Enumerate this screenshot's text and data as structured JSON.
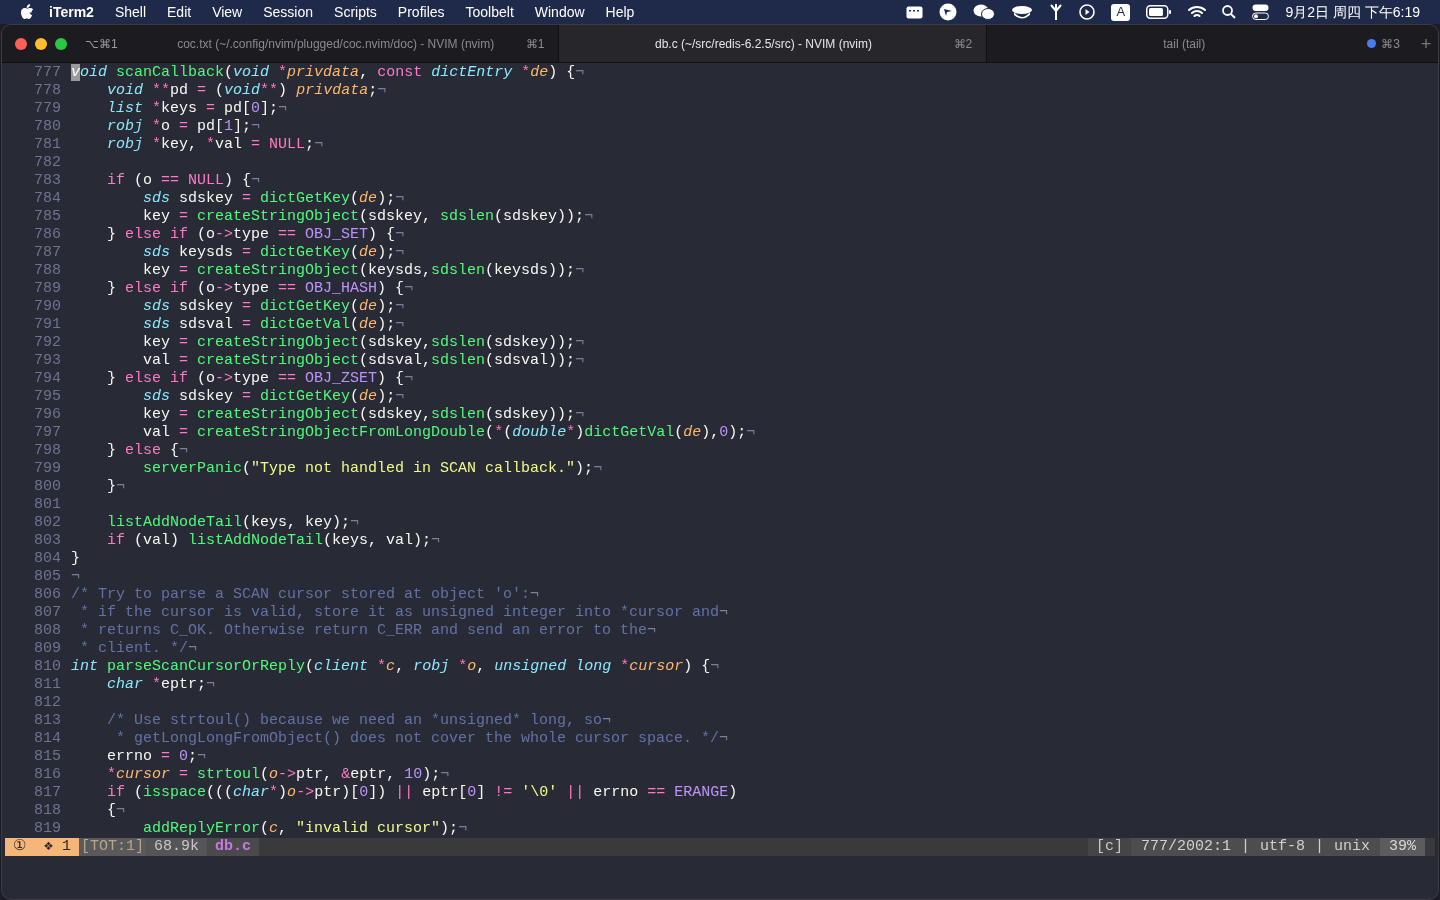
{
  "menu_bar": {
    "app": "iTerm2",
    "items": [
      "Shell",
      "Edit",
      "View",
      "Session",
      "Scripts",
      "Profiles",
      "Toolbelt",
      "Window",
      "Help"
    ],
    "input_source": "A",
    "clock": "9月2日 周四 下午6:19"
  },
  "window": {
    "shortcut": "⌥⌘1",
    "new_tab": "+",
    "tabs": [
      {
        "title": "coc.txt (~/.config/nvim/plugged/coc.nvim/doc) - NVIM (nvim)",
        "shortcut": "⌘1",
        "selected": false,
        "activity": false
      },
      {
        "title": "db.c (~/src/redis-6.2.5/src) - NVIM (nvim)",
        "shortcut": "⌘2",
        "selected": true,
        "activity": false
      },
      {
        "title": "tail (tail)",
        "shortcut": "⌘3",
        "selected": false,
        "activity": true
      }
    ]
  },
  "editor": {
    "lines": [
      {
        "number": "777",
        "tokens": [
          {
            "kind": "cursor",
            "text": "v"
          },
          {
            "kind": "type",
            "text": "oid"
          },
          {
            "kind": "func",
            "text": " scanCallback"
          },
          {
            "kind": "plain",
            "text": "("
          },
          {
            "kind": "type",
            "text": "void"
          },
          {
            "kind": "op",
            "text": " *"
          },
          {
            "kind": "param",
            "text": "privdata"
          },
          {
            "kind": "plain",
            "text": ", "
          },
          {
            "kind": "op",
            "text": "const"
          },
          {
            "kind": "type",
            "text": " dictEntry"
          },
          {
            "kind": "op",
            "text": " *"
          },
          {
            "kind": "param",
            "text": "de"
          },
          {
            "kind": "plain",
            "text": ") {"
          },
          {
            "kind": "eol",
            "text": "¬"
          }
        ]
      },
      {
        "number": "778",
        "tokens": [
          {
            "kind": "type",
            "text": "    void"
          },
          {
            "kind": "op",
            "text": " **"
          },
          {
            "kind": "plain",
            "text": "pd "
          },
          {
            "kind": "op",
            "text": "="
          },
          {
            "kind": "plain",
            "text": " ("
          },
          {
            "kind": "type",
            "text": "void"
          },
          {
            "kind": "op",
            "text": "**"
          },
          {
            "kind": "plain",
            "text": ") "
          },
          {
            "kind": "param",
            "text": "privdata"
          },
          {
            "kind": "plain",
            "text": ";"
          },
          {
            "kind": "eol",
            "text": "¬"
          }
        ]
      },
      {
        "number": "779",
        "tokens": [
          {
            "kind": "type",
            "text": "    list"
          },
          {
            "kind": "op",
            "text": " *"
          },
          {
            "kind": "plain",
            "text": "keys "
          },
          {
            "kind": "op",
            "text": "="
          },
          {
            "kind": "plain",
            "text": " pd["
          },
          {
            "kind": "num",
            "text": "0"
          },
          {
            "kind": "plain",
            "text": "];"
          },
          {
            "kind": "eol",
            "text": "¬"
          }
        ]
      },
      {
        "number": "780",
        "tokens": [
          {
            "kind": "type",
            "text": "    robj"
          },
          {
            "kind": "op",
            "text": " *"
          },
          {
            "kind": "plain",
            "text": "o "
          },
          {
            "kind": "op",
            "text": "="
          },
          {
            "kind": "plain",
            "text": " pd["
          },
          {
            "kind": "num",
            "text": "1"
          },
          {
            "kind": "plain",
            "text": "];"
          },
          {
            "kind": "eol",
            "text": "¬"
          }
        ]
      },
      {
        "number": "781",
        "tokens": [
          {
            "kind": "type",
            "text": "    robj"
          },
          {
            "kind": "op",
            "text": " *"
          },
          {
            "kind": "plain",
            "text": "key, "
          },
          {
            "kind": "op",
            "text": "*"
          },
          {
            "kind": "plain",
            "text": "val "
          },
          {
            "kind": "op",
            "text": "="
          },
          {
            "kind": "op",
            "text": " NULL"
          },
          {
            "kind": "plain",
            "text": ";"
          },
          {
            "kind": "eol",
            "text": "¬"
          }
        ]
      },
      {
        "number": "782"
      },
      {
        "number": "783",
        "tokens": [
          {
            "kind": "op",
            "text": "    if"
          },
          {
            "kind": "plain",
            "text": " (o "
          },
          {
            "kind": "op",
            "text": "=="
          },
          {
            "kind": "op",
            "text": " NULL"
          },
          {
            "kind": "plain",
            "text": ") {"
          },
          {
            "kind": "eol",
            "text": "¬"
          }
        ]
      },
      {
        "number": "784",
        "tokens": [
          {
            "kind": "type",
            "text": "        sds"
          },
          {
            "kind": "plain",
            "text": " sdskey "
          },
          {
            "kind": "op",
            "text": "="
          },
          {
            "kind": "func",
            "text": " dictGetKey"
          },
          {
            "kind": "plain",
            "text": "("
          },
          {
            "kind": "param",
            "text": "de"
          },
          {
            "kind": "plain",
            "text": ");"
          },
          {
            "kind": "eol",
            "text": "¬"
          }
        ]
      },
      {
        "number": "785",
        "tokens": [
          {
            "kind": "plain",
            "text": "        key "
          },
          {
            "kind": "op",
            "text": "="
          },
          {
            "kind": "func",
            "text": " createStringObject"
          },
          {
            "kind": "plain",
            "text": "(sdskey, "
          },
          {
            "kind": "func",
            "text": "sdslen"
          },
          {
            "kind": "plain",
            "text": "(sdskey));"
          },
          {
            "kind": "eol",
            "text": "¬"
          }
        ]
      },
      {
        "number": "786",
        "tokens": [
          {
            "kind": "plain",
            "text": "    } "
          },
          {
            "kind": "op",
            "text": "else if"
          },
          {
            "kind": "plain",
            "text": " (o"
          },
          {
            "kind": "op",
            "text": "->"
          },
          {
            "kind": "plain",
            "text": "type "
          },
          {
            "kind": "op",
            "text": "=="
          },
          {
            "kind": "const",
            "text": " OBJ_SET"
          },
          {
            "kind": "plain",
            "text": ") {"
          },
          {
            "kind": "eol",
            "text": "¬"
          }
        ]
      },
      {
        "number": "787",
        "tokens": [
          {
            "kind": "type",
            "text": "        sds"
          },
          {
            "kind": "plain",
            "text": " keysds "
          },
          {
            "kind": "op",
            "text": "="
          },
          {
            "kind": "func",
            "text": " dictGetKey"
          },
          {
            "kind": "plain",
            "text": "("
          },
          {
            "kind": "param",
            "text": "de"
          },
          {
            "kind": "plain",
            "text": ");"
          },
          {
            "kind": "eol",
            "text": "¬"
          }
        ]
      },
      {
        "number": "788",
        "tokens": [
          {
            "kind": "plain",
            "text": "        key "
          },
          {
            "kind": "op",
            "text": "="
          },
          {
            "kind": "func",
            "text": " createStringObject"
          },
          {
            "kind": "plain",
            "text": "(keysds,"
          },
          {
            "kind": "func",
            "text": "sdslen"
          },
          {
            "kind": "plain",
            "text": "(keysds));"
          },
          {
            "kind": "eol",
            "text": "¬"
          }
        ]
      },
      {
        "number": "789",
        "tokens": [
          {
            "kind": "plain",
            "text": "    } "
          },
          {
            "kind": "op",
            "text": "else if"
          },
          {
            "kind": "plain",
            "text": " (o"
          },
          {
            "kind": "op",
            "text": "->"
          },
          {
            "kind": "plain",
            "text": "type "
          },
          {
            "kind": "op",
            "text": "=="
          },
          {
            "kind": "const",
            "text": " OBJ_HASH"
          },
          {
            "kind": "plain",
            "text": ") {"
          },
          {
            "kind": "eol",
            "text": "¬"
          }
        ]
      },
      {
        "number": "790",
        "tokens": [
          {
            "kind": "type",
            "text": "        sds"
          },
          {
            "kind": "plain",
            "text": " sdskey "
          },
          {
            "kind": "op",
            "text": "="
          },
          {
            "kind": "func",
            "text": " dictGetKey"
          },
          {
            "kind": "plain",
            "text": "("
          },
          {
            "kind": "param",
            "text": "de"
          },
          {
            "kind": "plain",
            "text": ");"
          },
          {
            "kind": "eol",
            "text": "¬"
          }
        ]
      },
      {
        "number": "791",
        "tokens": [
          {
            "kind": "type",
            "text": "        sds"
          },
          {
            "kind": "plain",
            "text": " sdsval "
          },
          {
            "kind": "op",
            "text": "="
          },
          {
            "kind": "func",
            "text": " dictGetVal"
          },
          {
            "kind": "plain",
            "text": "("
          },
          {
            "kind": "param",
            "text": "de"
          },
          {
            "kind": "plain",
            "text": ");"
          },
          {
            "kind": "eol",
            "text": "¬"
          }
        ]
      },
      {
        "number": "792",
        "tokens": [
          {
            "kind": "plain",
            "text": "        key "
          },
          {
            "kind": "op",
            "text": "="
          },
          {
            "kind": "func",
            "text": " createStringObject"
          },
          {
            "kind": "plain",
            "text": "(sdskey,"
          },
          {
            "kind": "func",
            "text": "sdslen"
          },
          {
            "kind": "plain",
            "text": "(sdskey));"
          },
          {
            "kind": "eol",
            "text": "¬"
          }
        ]
      },
      {
        "number": "793",
        "tokens": [
          {
            "kind": "plain",
            "text": "        val "
          },
          {
            "kind": "op",
            "text": "="
          },
          {
            "kind": "func",
            "text": " createStringObject"
          },
          {
            "kind": "plain",
            "text": "(sdsval,"
          },
          {
            "kind": "func",
            "text": "sdslen"
          },
          {
            "kind": "plain",
            "text": "(sdsval));"
          },
          {
            "kind": "eol",
            "text": "¬"
          }
        ]
      },
      {
        "number": "794",
        "tokens": [
          {
            "kind": "plain",
            "text": "    } "
          },
          {
            "kind": "op",
            "text": "else if"
          },
          {
            "kind": "plain",
            "text": " (o"
          },
          {
            "kind": "op",
            "text": "->"
          },
          {
            "kind": "plain",
            "text": "type "
          },
          {
            "kind": "op",
            "text": "=="
          },
          {
            "kind": "const",
            "text": " OBJ_ZSET"
          },
          {
            "kind": "plain",
            "text": ") {"
          },
          {
            "kind": "eol",
            "text": "¬"
          }
        ]
      },
      {
        "number": "795",
        "tokens": [
          {
            "kind": "type",
            "text": "        sds"
          },
          {
            "kind": "plain",
            "text": " sdskey "
          },
          {
            "kind": "op",
            "text": "="
          },
          {
            "kind": "func",
            "text": " dictGetKey"
          },
          {
            "kind": "plain",
            "text": "("
          },
          {
            "kind": "param",
            "text": "de"
          },
          {
            "kind": "plain",
            "text": ");"
          },
          {
            "kind": "eol",
            "text": "¬"
          }
        ]
      },
      {
        "number": "796",
        "tokens": [
          {
            "kind": "plain",
            "text": "        key "
          },
          {
            "kind": "op",
            "text": "="
          },
          {
            "kind": "func",
            "text": " createStringObject"
          },
          {
            "kind": "plain",
            "text": "(sdskey,"
          },
          {
            "kind": "func",
            "text": "sdslen"
          },
          {
            "kind": "plain",
            "text": "(sdskey));"
          },
          {
            "kind": "eol",
            "text": "¬"
          }
        ]
      },
      {
        "number": "797",
        "tokens": [
          {
            "kind": "plain",
            "text": "        val "
          },
          {
            "kind": "op",
            "text": "="
          },
          {
            "kind": "func",
            "text": " createStringObjectFromLongDouble"
          },
          {
            "kind": "plain",
            "text": "("
          },
          {
            "kind": "op",
            "text": "*"
          },
          {
            "kind": "plain",
            "text": "("
          },
          {
            "kind": "type",
            "text": "double"
          },
          {
            "kind": "op",
            "text": "*"
          },
          {
            "kind": "plain",
            "text": ")"
          },
          {
            "kind": "func",
            "text": "dictGetVal"
          },
          {
            "kind": "plain",
            "text": "("
          },
          {
            "kind": "param",
            "text": "de"
          },
          {
            "kind": "plain",
            "text": "),"
          },
          {
            "kind": "num",
            "text": "0"
          },
          {
            "kind": "plain",
            "text": ");"
          },
          {
            "kind": "eol",
            "text": "¬"
          }
        ]
      },
      {
        "number": "798",
        "tokens": [
          {
            "kind": "plain",
            "text": "    } "
          },
          {
            "kind": "op",
            "text": "else"
          },
          {
            "kind": "plain",
            "text": " {"
          },
          {
            "kind": "eol",
            "text": "¬"
          }
        ]
      },
      {
        "number": "799",
        "tokens": [
          {
            "kind": "func",
            "text": "        serverPanic"
          },
          {
            "kind": "plain",
            "text": "("
          },
          {
            "kind": "str",
            "text": "\"Type not handled in SCAN callback.\""
          },
          {
            "kind": "plain",
            "text": ");"
          },
          {
            "kind": "eol",
            "text": "¬"
          }
        ]
      },
      {
        "number": "800",
        "tokens": [
          {
            "kind": "plain",
            "text": "    }"
          },
          {
            "kind": "eol",
            "text": "¬"
          }
        ]
      },
      {
        "number": "801"
      },
      {
        "number": "802",
        "tokens": [
          {
            "kind": "func",
            "text": "    listAddNodeTail"
          },
          {
            "kind": "plain",
            "text": "(keys, key);"
          },
          {
            "kind": "eol",
            "text": "¬"
          }
        ]
      },
      {
        "number": "803",
        "tokens": [
          {
            "kind": "op",
            "text": "    if"
          },
          {
            "kind": "plain",
            "text": " (val) "
          },
          {
            "kind": "func",
            "text": "listAddNodeTail"
          },
          {
            "kind": "plain",
            "text": "(keys, val);"
          },
          {
            "kind": "eol",
            "text": "¬"
          }
        ]
      },
      {
        "number": "804",
        "tokens": [
          {
            "kind": "plain",
            "text": "}"
          }
        ]
      },
      {
        "number": "805",
        "tokens": [
          {
            "kind": "eol",
            "text": "¬"
          }
        ]
      },
      {
        "number": "806",
        "tokens": [
          {
            "kind": "comment",
            "text": "/* Try to parse a SCAN cursor stored at object 'o':"
          },
          {
            "kind": "eol",
            "text": "¬"
          }
        ]
      },
      {
        "number": "807",
        "tokens": [
          {
            "kind": "comment",
            "text": " * if the cursor is valid, store it as unsigned integer into *cursor and"
          },
          {
            "kind": "eol",
            "text": "¬"
          }
        ]
      },
      {
        "number": "808",
        "tokens": [
          {
            "kind": "comment",
            "text": " * returns C_OK. Otherwise return C_ERR and send an error to the"
          },
          {
            "kind": "eol",
            "text": "¬"
          }
        ]
      },
      {
        "number": "809",
        "tokens": [
          {
            "kind": "comment",
            "text": " * client. */"
          },
          {
            "kind": "eol",
            "text": "¬"
          }
        ]
      },
      {
        "number": "810",
        "tokens": [
          {
            "kind": "type",
            "text": "int"
          },
          {
            "kind": "func",
            "text": " parseScanCursorOrReply"
          },
          {
            "kind": "plain",
            "text": "("
          },
          {
            "kind": "type",
            "text": "client"
          },
          {
            "kind": "op",
            "text": " *"
          },
          {
            "kind": "param",
            "text": "c"
          },
          {
            "kind": "plain",
            "text": ", "
          },
          {
            "kind": "type",
            "text": "robj"
          },
          {
            "kind": "op",
            "text": " *"
          },
          {
            "kind": "param",
            "text": "o"
          },
          {
            "kind": "plain",
            "text": ", "
          },
          {
            "kind": "type",
            "text": "unsigned long"
          },
          {
            "kind": "op",
            "text": " *"
          },
          {
            "kind": "param",
            "text": "cursor"
          },
          {
            "kind": "plain",
            "text": ") {"
          },
          {
            "kind": "eol",
            "text": "¬"
          }
        ]
      },
      {
        "number": "811",
        "tokens": [
          {
            "kind": "type",
            "text": "    char"
          },
          {
            "kind": "op",
            "text": " *"
          },
          {
            "kind": "plain",
            "text": "eptr;"
          },
          {
            "kind": "eol",
            "text": "¬"
          }
        ]
      },
      {
        "number": "812"
      },
      {
        "number": "813",
        "tokens": [
          {
            "kind": "comment",
            "text": "    /* Use strtoul() because we need an *unsigned* long, so"
          },
          {
            "kind": "eol",
            "text": "¬"
          }
        ]
      },
      {
        "number": "814",
        "tokens": [
          {
            "kind": "comment",
            "text": "     * getLongLongFromObject() does not cover the whole cursor space. */"
          },
          {
            "kind": "eol",
            "text": "¬"
          }
        ]
      },
      {
        "number": "815",
        "tokens": [
          {
            "kind": "plain",
            "text": "    errno "
          },
          {
            "kind": "op",
            "text": "="
          },
          {
            "kind": "num",
            "text": " 0"
          },
          {
            "kind": "plain",
            "text": ";"
          },
          {
            "kind": "eol",
            "text": "¬"
          }
        ]
      },
      {
        "number": "816",
        "tokens": [
          {
            "kind": "op",
            "text": "    *"
          },
          {
            "kind": "param",
            "text": "cursor"
          },
          {
            "kind": "op",
            "text": " ="
          },
          {
            "kind": "func",
            "text": " strtoul"
          },
          {
            "kind": "plain",
            "text": "("
          },
          {
            "kind": "param",
            "text": "o"
          },
          {
            "kind": "op",
            "text": "->"
          },
          {
            "kind": "plain",
            "text": "ptr, "
          },
          {
            "kind": "op",
            "text": "&"
          },
          {
            "kind": "plain",
            "text": "eptr, "
          },
          {
            "kind": "num",
            "text": "10"
          },
          {
            "kind": "plain",
            "text": ");"
          },
          {
            "kind": "eol",
            "text": "¬"
          }
        ]
      },
      {
        "number": "817",
        "tokens": [
          {
            "kind": "op",
            "text": "    if"
          },
          {
            "kind": "plain",
            "text": " ("
          },
          {
            "kind": "func",
            "text": "isspace"
          },
          {
            "kind": "plain",
            "text": "((("
          },
          {
            "kind": "type",
            "text": "char"
          },
          {
            "kind": "op",
            "text": "*"
          },
          {
            "kind": "plain",
            "text": ")"
          },
          {
            "kind": "param",
            "text": "o"
          },
          {
            "kind": "op",
            "text": "->"
          },
          {
            "kind": "plain",
            "text": "ptr)["
          },
          {
            "kind": "num",
            "text": "0"
          },
          {
            "kind": "plain",
            "text": "]) "
          },
          {
            "kind": "op",
            "text": "||"
          },
          {
            "kind": "plain",
            "text": " eptr["
          },
          {
            "kind": "num",
            "text": "0"
          },
          {
            "kind": "plain",
            "text": "] "
          },
          {
            "kind": "op",
            "text": "!="
          },
          {
            "kind": "str",
            "text": " '\\0'"
          },
          {
            "kind": "op",
            "text": " ||"
          },
          {
            "kind": "plain",
            "text": " errno "
          },
          {
            "kind": "op",
            "text": "=="
          },
          {
            "kind": "const",
            "text": " ERANGE"
          },
          {
            "kind": "plain",
            "text": ")"
          }
        ]
      },
      {
        "number": "818",
        "tokens": [
          {
            "kind": "plain",
            "text": "    {"
          },
          {
            "kind": "eol",
            "text": "¬"
          }
        ]
      },
      {
        "number": "819",
        "tokens": [
          {
            "kind": "func",
            "text": "        addReplyError"
          },
          {
            "kind": "plain",
            "text": "("
          },
          {
            "kind": "param",
            "text": "c"
          },
          {
            "kind": "plain",
            "text": ", "
          },
          {
            "kind": "str",
            "text": "\"invalid cursor\""
          },
          {
            "kind": "plain",
            "text": ");"
          },
          {
            "kind": "eol",
            "text": "¬"
          }
        ]
      }
    ]
  },
  "status_line": {
    "left": [
      {
        "kind": "mode",
        "text": "①  ❖ 1"
      },
      {
        "kind": "warning",
        "text": "[TOT:1]"
      },
      {
        "kind": "size",
        "text": "68.9k"
      },
      {
        "kind": "filename",
        "text": "db.c"
      }
    ],
    "right": [
      {
        "kind": "filetype",
        "text": "[c]"
      },
      {
        "kind": "info",
        "text": "777/2002:1"
      },
      {
        "kind": "sep",
        "text": "|"
      },
      {
        "kind": "info",
        "text": "utf-8"
      },
      {
        "kind": "sep",
        "text": "|"
      },
      {
        "kind": "info",
        "text": "unix"
      },
      {
        "kind": "percent",
        "text": "39%"
      }
    ]
  }
}
